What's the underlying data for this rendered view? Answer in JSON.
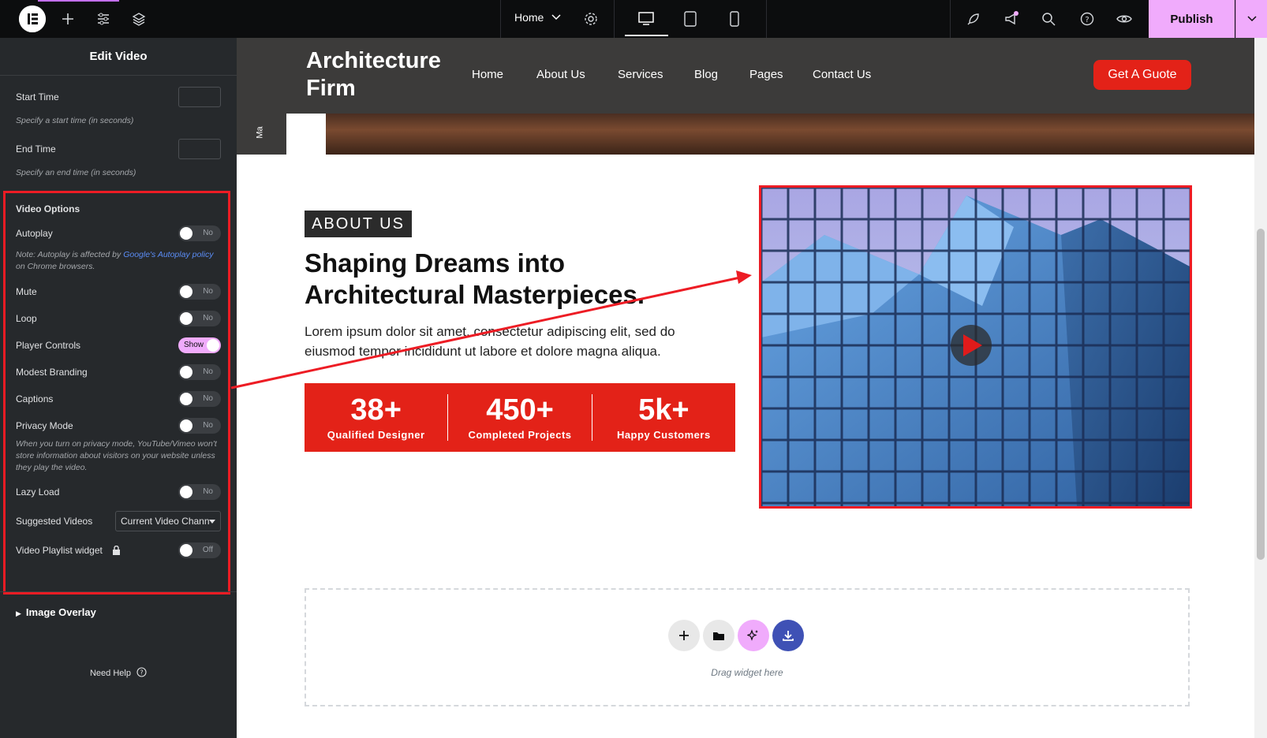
{
  "topbar": {
    "page_name": "Home",
    "publish_label": "Publish"
  },
  "panel": {
    "title": "Edit Video",
    "start_time": {
      "label": "Start Time",
      "hint": "Specify a start time (in seconds)"
    },
    "end_time": {
      "label": "End Time",
      "hint": "Specify an end time (in seconds)"
    },
    "video_options_title": "Video Options",
    "autoplay": {
      "label": "Autoplay",
      "state": "No"
    },
    "autoplay_note_prefix": "Note: Autoplay is affected by ",
    "autoplay_note_link": "Google's Autoplay policy",
    "autoplay_note_suffix": " on Chrome browsers.",
    "mute": {
      "label": "Mute",
      "state": "No"
    },
    "loop": {
      "label": "Loop",
      "state": "No"
    },
    "player_controls": {
      "label": "Player Controls",
      "state": "Show"
    },
    "modest_branding": {
      "label": "Modest Branding",
      "state": "No"
    },
    "captions": {
      "label": "Captions",
      "state": "No"
    },
    "privacy_mode": {
      "label": "Privacy Mode",
      "state": "No"
    },
    "privacy_note": "When you turn on privacy mode, YouTube/Vimeo won't store information about visitors on your website unless they play the video.",
    "lazy_load": {
      "label": "Lazy Load",
      "state": "No"
    },
    "suggested_videos": {
      "label": "Suggested Videos",
      "value": "Current Video Chann"
    },
    "playlist_widget": {
      "label": "Video Playlist widget",
      "state": "Off"
    },
    "image_overlay": "Image Overlay",
    "need_help": "Need Help"
  },
  "site": {
    "brand": "Architecture Firm",
    "nav": [
      "Home",
      "About Us",
      "Services",
      "Blog",
      "Pages",
      "Contact Us"
    ],
    "cta": "Get A Guote",
    "side_tab": "Ma",
    "badge": "ABOUT US",
    "headline": "Shaping Dreams into Architectural Masterpieces.",
    "paragraph": "Lorem ipsum dolor sit amet, consectetur adipiscing elit, sed do eiusmod tempor incididunt ut labore et dolore magna aliqua.",
    "stats": [
      {
        "num": "38+",
        "cap": "Qualified Designer"
      },
      {
        "num": "450+",
        "cap": "Completed Projects"
      },
      {
        "num": "5k+",
        "cap": "Happy Customers"
      }
    ],
    "drop_text": "Drag widget here"
  },
  "colors": {
    "accent_pink": "#f0abfc",
    "brand_red": "#e32218",
    "annotation_red": "#ed1c24"
  }
}
